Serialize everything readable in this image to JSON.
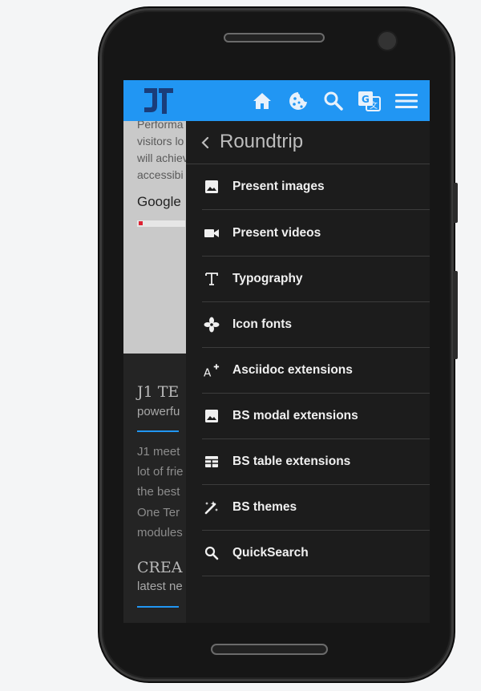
{
  "background_page": {
    "light_lines": [
      "Performa",
      "visitors lo",
      "will achiev",
      "accessibi"
    ],
    "light_heading": "Google",
    "dark_title_1": "J1 TE",
    "dark_sub_1": "powerfu",
    "dark_lines": [
      "J1 meet",
      "lot of frie",
      "the best",
      "One Ter",
      "modules"
    ],
    "dark_title_2": "CREA",
    "dark_sub_2": "latest ne"
  },
  "header": {
    "icons": [
      "home-icon",
      "cookie-icon",
      "search-icon",
      "translate-icon",
      "menu-icon"
    ],
    "accent": "#2196f3"
  },
  "menu": {
    "title": "Roundtrip",
    "items": [
      {
        "label": "Present images",
        "icon": "image-icon"
      },
      {
        "label": "Present videos",
        "icon": "video-icon"
      },
      {
        "label": "Typography",
        "icon": "text-icon"
      },
      {
        "label": "Icon fonts",
        "icon": "fan-icon"
      },
      {
        "label": "Asciidoc extensions",
        "icon": "font-add-icon"
      },
      {
        "label": "BS modal extensions",
        "icon": "image-icon"
      },
      {
        "label": "BS table extensions",
        "icon": "table-icon"
      },
      {
        "label": "BS themes",
        "icon": "magic-wand-icon"
      },
      {
        "label": "QuickSearch",
        "icon": "search-icon"
      }
    ]
  }
}
